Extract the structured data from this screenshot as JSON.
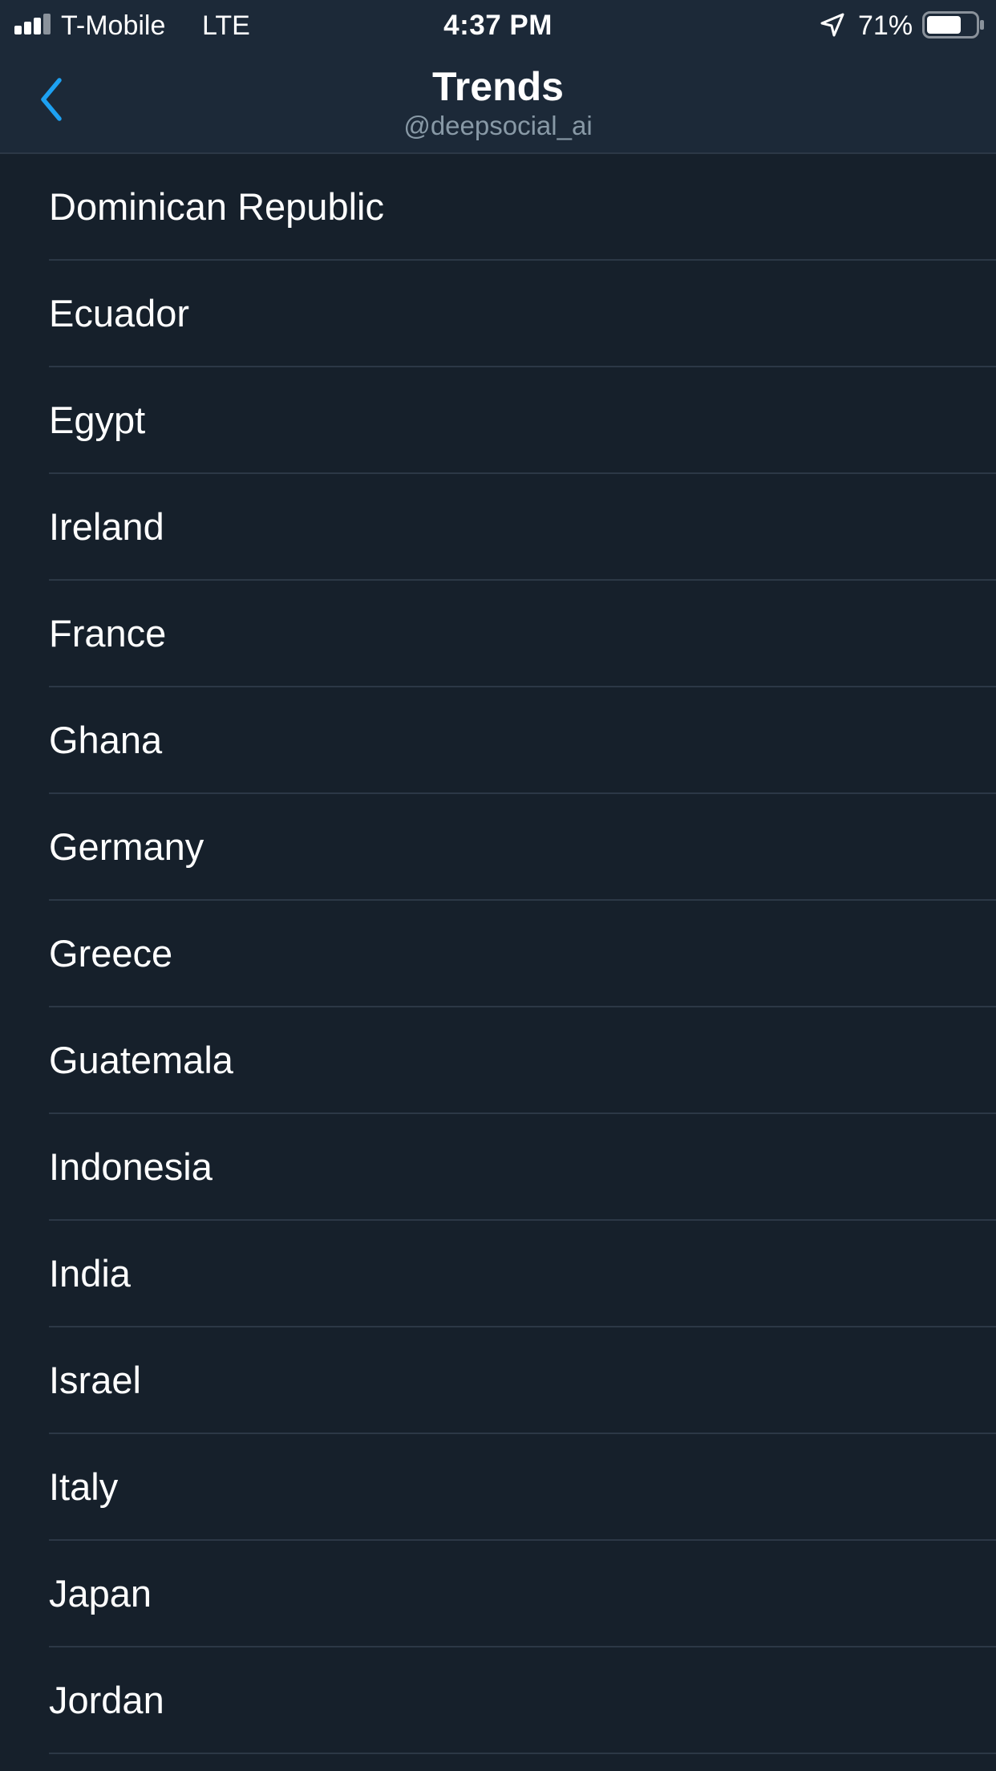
{
  "status_bar": {
    "carrier": "T-Mobile",
    "network": "LTE",
    "time": "4:37 PM",
    "battery_percent": "71%",
    "battery_level": 0.71,
    "signal_bars": 3,
    "signal_bars_total": 4,
    "icons": [
      "signal-icon",
      "location-arrow-icon",
      "battery-icon"
    ]
  },
  "nav": {
    "title": "Trends",
    "subtitle": "@deepsocial_ai",
    "back_icon": "chevron-left-icon"
  },
  "colors": {
    "background": "#16202b",
    "header_background": "#1c2938",
    "accent": "#1da1f2",
    "divider": "#2c3846",
    "subtitle": "#8899a6",
    "text": "#ffffff"
  },
  "locations": [
    {
      "label": "Dominican Republic"
    },
    {
      "label": "Ecuador"
    },
    {
      "label": "Egypt"
    },
    {
      "label": "Ireland"
    },
    {
      "label": "France"
    },
    {
      "label": "Ghana"
    },
    {
      "label": "Germany"
    },
    {
      "label": "Greece"
    },
    {
      "label": "Guatemala"
    },
    {
      "label": "Indonesia"
    },
    {
      "label": "India"
    },
    {
      "label": "Israel"
    },
    {
      "label": "Italy"
    },
    {
      "label": "Japan"
    },
    {
      "label": "Jordan"
    }
  ]
}
